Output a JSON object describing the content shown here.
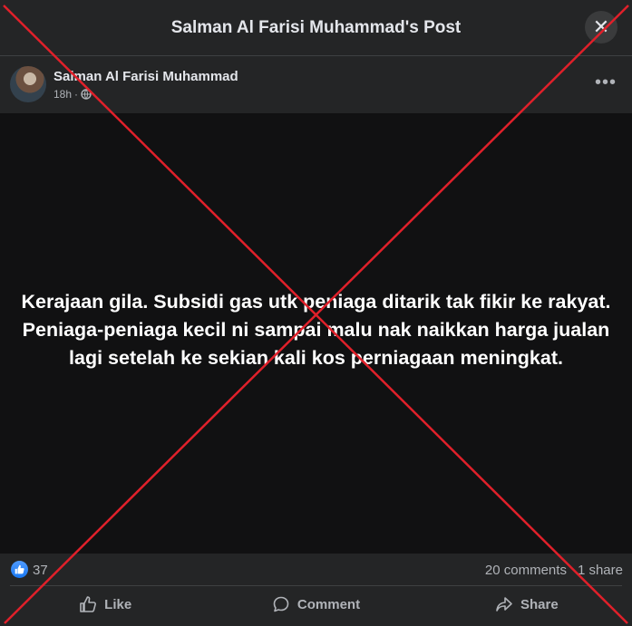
{
  "header": {
    "title": "Salman Al Farisi Muhammad's Post",
    "close_glyph": "✕"
  },
  "post": {
    "author": "Salman Al Farisi Muhammad",
    "time": "18h",
    "separator": "·",
    "privacy_icon": "globe-icon",
    "more_glyph": "•••",
    "text": "Kerajaan gila. Subsidi gas utk peniaga ditarik tak fikir ke rakyat. Peniaga-peniaga kecil ni sampai malu nak naikkan harga jualan lagi setelah ke sekian kali kos perniagaan meningkat."
  },
  "stats": {
    "reaction_icon": "like-icon",
    "likes": "37",
    "comments": "20 comments",
    "shares": "1 share"
  },
  "actions": {
    "like": "Like",
    "comment": "Comment",
    "share": "Share"
  },
  "colors": {
    "background": "#242526",
    "post_body": "#111112",
    "like_blue": "#1877f2",
    "cross_red": "#e0202a"
  }
}
